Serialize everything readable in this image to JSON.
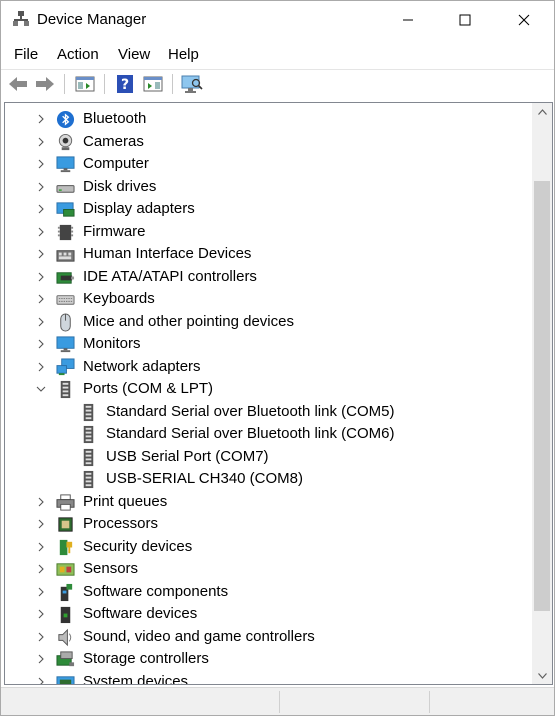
{
  "window": {
    "title": "Device Manager",
    "controls": {
      "minimize": "minimize",
      "maximize": "maximize",
      "close": "close"
    }
  },
  "menubar": {
    "items": [
      "File",
      "Action",
      "View",
      "Help"
    ]
  },
  "toolbar": {
    "buttons": [
      {
        "name": "back",
        "icon": "arrow-left-icon"
      },
      {
        "name": "forward",
        "icon": "arrow-right-icon"
      },
      {
        "name": "show-hide-console-tree",
        "icon": "console-tree-icon"
      },
      {
        "name": "help",
        "icon": "help-icon"
      },
      {
        "name": "show-hide-action-pane",
        "icon": "action-pane-icon"
      },
      {
        "name": "scan-hardware",
        "icon": "monitor-scan-icon"
      }
    ]
  },
  "tree": {
    "items": [
      {
        "label": "Bluetooth",
        "icon": "bluetooth-icon",
        "expanded": false
      },
      {
        "label": "Cameras",
        "icon": "camera-icon",
        "expanded": false
      },
      {
        "label": "Computer",
        "icon": "computer-icon",
        "expanded": false
      },
      {
        "label": "Disk drives",
        "icon": "disk-drive-icon",
        "expanded": false
      },
      {
        "label": "Display adapters",
        "icon": "display-adapter-icon",
        "expanded": false
      },
      {
        "label": "Firmware",
        "icon": "firmware-icon",
        "expanded": false
      },
      {
        "label": "Human Interface Devices",
        "icon": "hid-icon",
        "expanded": false
      },
      {
        "label": "IDE ATA/ATAPI controllers",
        "icon": "ide-controller-icon",
        "expanded": false
      },
      {
        "label": "Keyboards",
        "icon": "keyboard-icon",
        "expanded": false
      },
      {
        "label": "Mice and other pointing devices",
        "icon": "mouse-icon",
        "expanded": false
      },
      {
        "label": "Monitors",
        "icon": "monitor-icon",
        "expanded": false
      },
      {
        "label": "Network adapters",
        "icon": "network-adapter-icon",
        "expanded": false
      },
      {
        "label": "Ports (COM & LPT)",
        "icon": "port-icon",
        "expanded": true,
        "children": [
          {
            "label": "Standard Serial over Bluetooth link (COM5)",
            "icon": "port-icon"
          },
          {
            "label": "Standard Serial over Bluetooth link (COM6)",
            "icon": "port-icon"
          },
          {
            "label": "USB Serial Port (COM7)",
            "icon": "port-icon"
          },
          {
            "label": "USB-SERIAL CH340 (COM8)",
            "icon": "port-icon"
          }
        ]
      },
      {
        "label": "Print queues",
        "icon": "printer-icon",
        "expanded": false
      },
      {
        "label": "Processors",
        "icon": "processor-icon",
        "expanded": false
      },
      {
        "label": "Security devices",
        "icon": "security-device-icon",
        "expanded": false
      },
      {
        "label": "Sensors",
        "icon": "sensor-icon",
        "expanded": false
      },
      {
        "label": "Software components",
        "icon": "software-component-icon",
        "expanded": false
      },
      {
        "label": "Software devices",
        "icon": "software-device-icon",
        "expanded": false
      },
      {
        "label": "Sound, video and game controllers",
        "icon": "sound-icon",
        "expanded": false
      },
      {
        "label": "Storage controllers",
        "icon": "storage-controller-icon",
        "expanded": false
      },
      {
        "label": "System devices",
        "icon": "system-device-icon",
        "expanded": false
      }
    ]
  },
  "colors": {
    "accent_blue": "#1e78d2",
    "scroll_thumb": "#cdcdcd",
    "scroll_track": "#f0f0f0"
  }
}
